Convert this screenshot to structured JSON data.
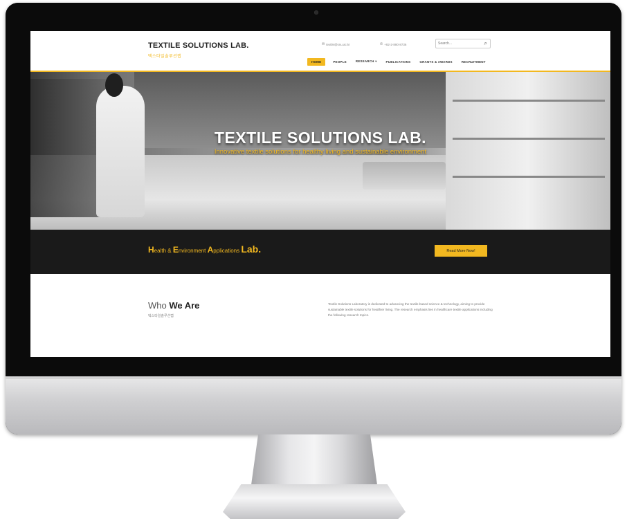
{
  "site": {
    "title": "TEXTILE SOLUTIONS LAB.",
    "subtitle": "텍스타일솔루션랩",
    "contact_email": "textile@snu.ac.kr",
    "contact_phone": "+82-2-880-8736",
    "search_placeholder": "Search..."
  },
  "nav": {
    "items": [
      "HOME",
      "PEOPLE",
      "RESEARCH ▾",
      "PUBLICATIONS",
      "GRANTS & AWARDS",
      "RECRUITMENT"
    ],
    "active": "HOME"
  },
  "hero": {
    "title": "TEXTILE SOLUTIONS LAB.",
    "tagline": "Innovative textile solutions for healthy living and sustainable environment"
  },
  "band": {
    "h": "H",
    "ealth": "ealth & ",
    "e": "E",
    "nvironment": "nvironment ",
    "a": "A",
    "pplications": "pplications ",
    "lab": "Lab.",
    "button": "Read More Now!"
  },
  "who": {
    "title_light": "Who ",
    "title_bold": "We Are",
    "subtitle": "텍스타일솔루션랩",
    "description": "Textile Solutions Laboratory is dedicated to advancing the textile-based science & technology, aiming to provide sustainable textile solutions for healthier living. The research emphasis lies in healthcare textile applications including the following research topics."
  },
  "colors": {
    "accent": "#f2b820",
    "band_bg": "#1a1a1a",
    "bezel": "#0b0b0b"
  }
}
